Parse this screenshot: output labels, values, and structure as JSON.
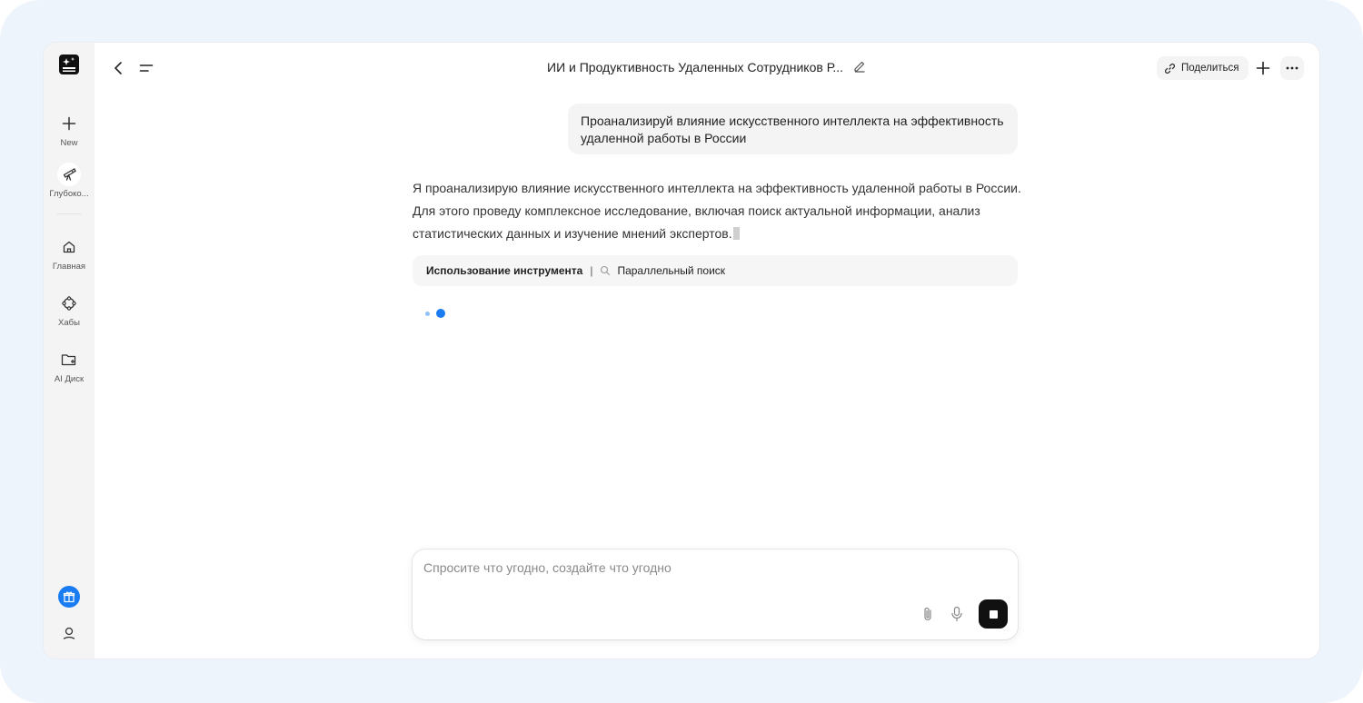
{
  "sidebar": {
    "new_label": "New",
    "deep_label": "Глубоко...",
    "home_label": "Главная",
    "hubs_label": "Хабы",
    "disk_label": "AI Диск"
  },
  "header": {
    "title": "ИИ и Продуктивность Удаленных Сотрудников Р...",
    "share_label": "Поделиться"
  },
  "chat": {
    "user_message": "Проанализируй влияние искусственного интеллекта на эффективность удаленной работы в России",
    "ai_message": "Я проанализирую влияние искусственного интеллекта на эффективность удаленной работы в России. Для этого проведу комплексное исследование, включая поиск актуальной информации, анализ статистических данных и изучение мнений экспертов.",
    "tool_label": "Использование инструмента",
    "tool_separator": "|",
    "tool_action": "Параллельный поиск"
  },
  "composer": {
    "placeholder": "Спросите что угодно, создайте что угодно"
  },
  "colors": {
    "accent": "#1a7cf2",
    "frame_bg": "#eef4fb",
    "sidebar_bg": "#f4f4f5"
  },
  "icons": {
    "logo": "ai-logo-icon",
    "new": "plus-icon",
    "deep": "telescope-icon",
    "home": "home-icon",
    "hubs": "hubs-icon",
    "disk": "folder-icon",
    "gift": "gift-icon",
    "user": "user-icon"
  }
}
